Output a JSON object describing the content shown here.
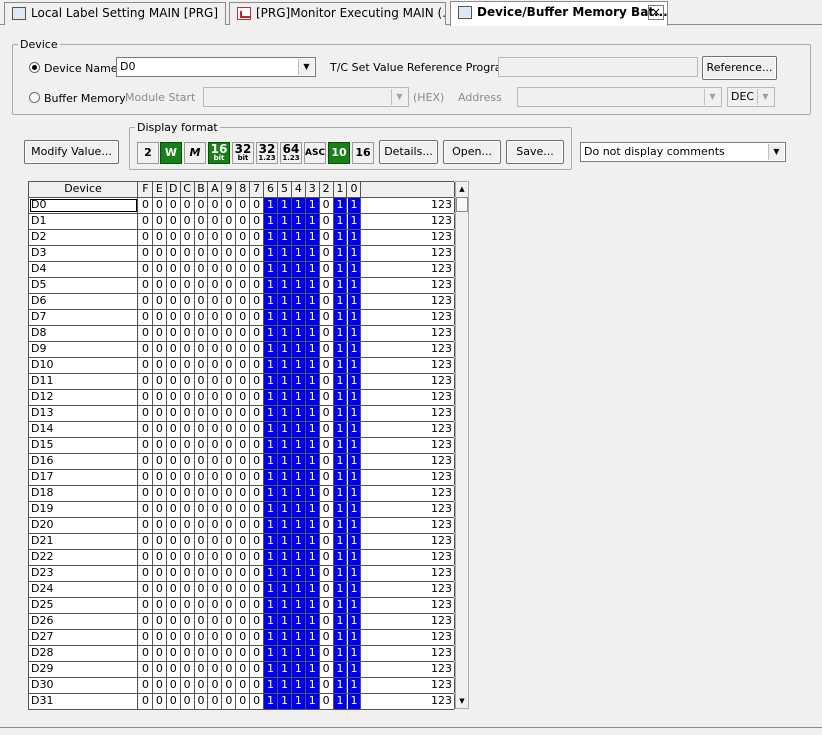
{
  "tabs": [
    {
      "label": "Local Label Setting MAIN [PRG]",
      "icon": "label-table-icon"
    },
    {
      "label": "[PRG]Monitor Executing MAIN (...",
      "icon": "monitor-program-icon"
    },
    {
      "label": "Device/Buffer Memory Bat...",
      "icon": "device-memory-icon",
      "active": true
    }
  ],
  "device_group": {
    "legend": "Device",
    "device_name_label": "Device Name",
    "device_name_value": "D0",
    "tc_label": "T/C Set Value Reference Program",
    "reference_button": "Reference...",
    "buffer_memory_label": "Buffer Memory",
    "module_start_label": "Module Start",
    "hex_label": "(HEX)",
    "address_label": "Address",
    "dec_value": "DEC"
  },
  "toolbar": {
    "modify_value_button": "Modify Value...",
    "display_format_legend": "Display format",
    "formats": [
      {
        "id": "bin",
        "text": "2",
        "sub": "",
        "active": false,
        "icon": "binary-format-icon"
      },
      {
        "id": "word",
        "text": "W",
        "sub": "",
        "active": true,
        "icon": "word-format-icon"
      },
      {
        "id": "dword",
        "text": "M",
        "sub": "",
        "active": false,
        "icon": "double-word-format-icon"
      },
      {
        "id": "16bit",
        "text": "16",
        "sub": "bit",
        "active": true,
        "icon": "16bit-format-icon"
      },
      {
        "id": "32bit",
        "text": "32",
        "sub": "bit",
        "active": false,
        "icon": "32bit-format-icon"
      },
      {
        "id": "32real",
        "text": "32",
        "sub": "1.23",
        "active": false,
        "icon": "32bit-real-format-icon"
      },
      {
        "id": "64real",
        "text": "64",
        "sub": "1.23",
        "active": false,
        "icon": "64bit-real-format-icon"
      },
      {
        "id": "asc",
        "text": "ASC",
        "sub": "",
        "active": false,
        "icon": "ascii-format-icon"
      },
      {
        "id": "dec",
        "text": "10",
        "sub": "",
        "active": true,
        "icon": "decimal-format-icon"
      },
      {
        "id": "hex",
        "text": "16",
        "sub": "",
        "active": false,
        "icon": "hex-format-icon"
      }
    ],
    "details_button": "Details...",
    "open_button": "Open...",
    "save_button": "Save...",
    "comments_select": "Do not display comments"
  },
  "grid": {
    "device_header": "Device",
    "bit_headers": [
      "F",
      "E",
      "D",
      "C",
      "B",
      "A",
      "9",
      "8",
      "7",
      "6",
      "5",
      "4",
      "3",
      "2",
      "1",
      "0"
    ],
    "rows": [
      {
        "device": "D0",
        "bits": [
          0,
          0,
          0,
          0,
          0,
          0,
          0,
          0,
          0,
          1,
          1,
          1,
          1,
          0,
          1,
          1
        ],
        "value": "123"
      },
      {
        "device": "D1",
        "bits": [
          0,
          0,
          0,
          0,
          0,
          0,
          0,
          0,
          0,
          1,
          1,
          1,
          1,
          0,
          1,
          1
        ],
        "value": "123"
      },
      {
        "device": "D2",
        "bits": [
          0,
          0,
          0,
          0,
          0,
          0,
          0,
          0,
          0,
          1,
          1,
          1,
          1,
          0,
          1,
          1
        ],
        "value": "123"
      },
      {
        "device": "D3",
        "bits": [
          0,
          0,
          0,
          0,
          0,
          0,
          0,
          0,
          0,
          1,
          1,
          1,
          1,
          0,
          1,
          1
        ],
        "value": "123"
      },
      {
        "device": "D4",
        "bits": [
          0,
          0,
          0,
          0,
          0,
          0,
          0,
          0,
          0,
          1,
          1,
          1,
          1,
          0,
          1,
          1
        ],
        "value": "123"
      },
      {
        "device": "D5",
        "bits": [
          0,
          0,
          0,
          0,
          0,
          0,
          0,
          0,
          0,
          1,
          1,
          1,
          1,
          0,
          1,
          1
        ],
        "value": "123"
      },
      {
        "device": "D6",
        "bits": [
          0,
          0,
          0,
          0,
          0,
          0,
          0,
          0,
          0,
          1,
          1,
          1,
          1,
          0,
          1,
          1
        ],
        "value": "123"
      },
      {
        "device": "D7",
        "bits": [
          0,
          0,
          0,
          0,
          0,
          0,
          0,
          0,
          0,
          1,
          1,
          1,
          1,
          0,
          1,
          1
        ],
        "value": "123"
      },
      {
        "device": "D8",
        "bits": [
          0,
          0,
          0,
          0,
          0,
          0,
          0,
          0,
          0,
          1,
          1,
          1,
          1,
          0,
          1,
          1
        ],
        "value": "123"
      },
      {
        "device": "D9",
        "bits": [
          0,
          0,
          0,
          0,
          0,
          0,
          0,
          0,
          0,
          1,
          1,
          1,
          1,
          0,
          1,
          1
        ],
        "value": "123"
      },
      {
        "device": "D10",
        "bits": [
          0,
          0,
          0,
          0,
          0,
          0,
          0,
          0,
          0,
          1,
          1,
          1,
          1,
          0,
          1,
          1
        ],
        "value": "123"
      },
      {
        "device": "D11",
        "bits": [
          0,
          0,
          0,
          0,
          0,
          0,
          0,
          0,
          0,
          1,
          1,
          1,
          1,
          0,
          1,
          1
        ],
        "value": "123"
      },
      {
        "device": "D12",
        "bits": [
          0,
          0,
          0,
          0,
          0,
          0,
          0,
          0,
          0,
          1,
          1,
          1,
          1,
          0,
          1,
          1
        ],
        "value": "123"
      },
      {
        "device": "D13",
        "bits": [
          0,
          0,
          0,
          0,
          0,
          0,
          0,
          0,
          0,
          1,
          1,
          1,
          1,
          0,
          1,
          1
        ],
        "value": "123"
      },
      {
        "device": "D14",
        "bits": [
          0,
          0,
          0,
          0,
          0,
          0,
          0,
          0,
          0,
          1,
          1,
          1,
          1,
          0,
          1,
          1
        ],
        "value": "123"
      },
      {
        "device": "D15",
        "bits": [
          0,
          0,
          0,
          0,
          0,
          0,
          0,
          0,
          0,
          1,
          1,
          1,
          1,
          0,
          1,
          1
        ],
        "value": "123"
      },
      {
        "device": "D16",
        "bits": [
          0,
          0,
          0,
          0,
          0,
          0,
          0,
          0,
          0,
          1,
          1,
          1,
          1,
          0,
          1,
          1
        ],
        "value": "123"
      },
      {
        "device": "D17",
        "bits": [
          0,
          0,
          0,
          0,
          0,
          0,
          0,
          0,
          0,
          1,
          1,
          1,
          1,
          0,
          1,
          1
        ],
        "value": "123"
      },
      {
        "device": "D18",
        "bits": [
          0,
          0,
          0,
          0,
          0,
          0,
          0,
          0,
          0,
          1,
          1,
          1,
          1,
          0,
          1,
          1
        ],
        "value": "123"
      },
      {
        "device": "D19",
        "bits": [
          0,
          0,
          0,
          0,
          0,
          0,
          0,
          0,
          0,
          1,
          1,
          1,
          1,
          0,
          1,
          1
        ],
        "value": "123"
      },
      {
        "device": "D20",
        "bits": [
          0,
          0,
          0,
          0,
          0,
          0,
          0,
          0,
          0,
          1,
          1,
          1,
          1,
          0,
          1,
          1
        ],
        "value": "123"
      },
      {
        "device": "D21",
        "bits": [
          0,
          0,
          0,
          0,
          0,
          0,
          0,
          0,
          0,
          1,
          1,
          1,
          1,
          0,
          1,
          1
        ],
        "value": "123"
      },
      {
        "device": "D22",
        "bits": [
          0,
          0,
          0,
          0,
          0,
          0,
          0,
          0,
          0,
          1,
          1,
          1,
          1,
          0,
          1,
          1
        ],
        "value": "123"
      },
      {
        "device": "D23",
        "bits": [
          0,
          0,
          0,
          0,
          0,
          0,
          0,
          0,
          0,
          1,
          1,
          1,
          1,
          0,
          1,
          1
        ],
        "value": "123"
      },
      {
        "device": "D24",
        "bits": [
          0,
          0,
          0,
          0,
          0,
          0,
          0,
          0,
          0,
          1,
          1,
          1,
          1,
          0,
          1,
          1
        ],
        "value": "123"
      },
      {
        "device": "D25",
        "bits": [
          0,
          0,
          0,
          0,
          0,
          0,
          0,
          0,
          0,
          1,
          1,
          1,
          1,
          0,
          1,
          1
        ],
        "value": "123"
      },
      {
        "device": "D26",
        "bits": [
          0,
          0,
          0,
          0,
          0,
          0,
          0,
          0,
          0,
          1,
          1,
          1,
          1,
          0,
          1,
          1
        ],
        "value": "123"
      },
      {
        "device": "D27",
        "bits": [
          0,
          0,
          0,
          0,
          0,
          0,
          0,
          0,
          0,
          1,
          1,
          1,
          1,
          0,
          1,
          1
        ],
        "value": "123"
      },
      {
        "device": "D28",
        "bits": [
          0,
          0,
          0,
          0,
          0,
          0,
          0,
          0,
          0,
          1,
          1,
          1,
          1,
          0,
          1,
          1
        ],
        "value": "123"
      },
      {
        "device": "D29",
        "bits": [
          0,
          0,
          0,
          0,
          0,
          0,
          0,
          0,
          0,
          1,
          1,
          1,
          1,
          0,
          1,
          1
        ],
        "value": "123"
      },
      {
        "device": "D30",
        "bits": [
          0,
          0,
          0,
          0,
          0,
          0,
          0,
          0,
          0,
          1,
          1,
          1,
          1,
          0,
          1,
          1
        ],
        "value": "123"
      },
      {
        "device": "D31",
        "bits": [
          0,
          0,
          0,
          0,
          0,
          0,
          0,
          0,
          0,
          1,
          1,
          1,
          1,
          0,
          1,
          1
        ],
        "value": "123"
      }
    ]
  },
  "colors": {
    "bit_on": "#0000ee",
    "format_active": "#188018"
  }
}
